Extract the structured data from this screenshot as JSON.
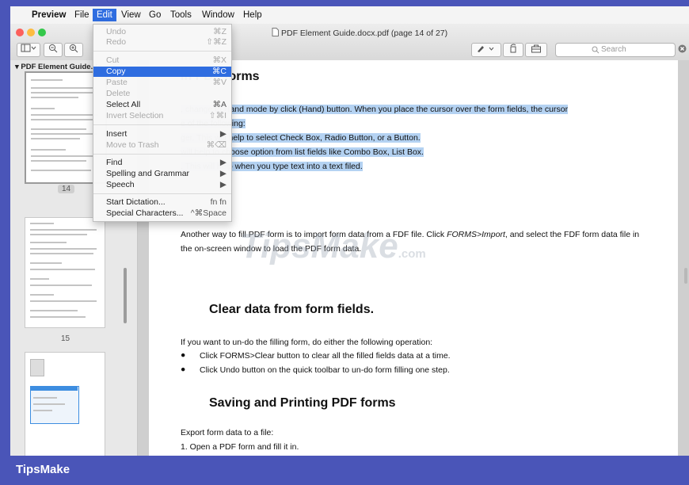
{
  "menubar": {
    "apple": "",
    "items": [
      "Preview",
      "File",
      "Edit",
      "View",
      "Go",
      "Tools",
      "Window",
      "Help"
    ]
  },
  "toolbar": {
    "doc_title": "PDF Element Guide.docx.pdf (page 14 of 27)",
    "search_placeholder": "Search",
    "zoom_out": "−",
    "zoom_in": "+"
  },
  "sidebar": {
    "title": "PDF Element Guide.do",
    "pages": [
      "14",
      "15"
    ]
  },
  "edit_menu": {
    "items": [
      {
        "label": "Undo",
        "shortcut": "⌘Z",
        "enabled": false
      },
      {
        "label": "Redo",
        "shortcut": "⇧⌘Z",
        "enabled": false
      },
      {
        "label": "Cut",
        "shortcut": "⌘X",
        "enabled": false
      },
      {
        "label": "Copy",
        "shortcut": "⌘C",
        "enabled": true,
        "selected": true
      },
      {
        "label": "Paste",
        "shortcut": "⌘V",
        "enabled": false
      },
      {
        "label": "Delete",
        "shortcut": "",
        "enabled": false
      },
      {
        "label": "Select All",
        "shortcut": "⌘A",
        "enabled": true
      },
      {
        "label": "Invert Selection",
        "shortcut": "⇧⌘I",
        "enabled": false
      },
      {
        "label": "Insert",
        "shortcut": "▶",
        "enabled": true
      },
      {
        "label": "Move to Trash",
        "shortcut": "⌘⌫",
        "enabled": false
      },
      {
        "label": "Find",
        "shortcut": "▶",
        "enabled": true
      },
      {
        "label": "Spelling and Grammar",
        "shortcut": "▶",
        "enabled": true
      },
      {
        "label": "Speech",
        "shortcut": "▶",
        "enabled": true
      },
      {
        "label": "Start Dictation...",
        "shortcut": "fn fn",
        "enabled": true
      },
      {
        "label": "Special Characters...",
        "shortcut": "^⌘Space",
        "enabled": true
      }
    ]
  },
  "document": {
    "heading1": "in PDF forms",
    "hl1": ", change to Hand mode by click (Hand) button. When you place the cursor over the form fields, the cursor",
    "hl2": "e of the following:",
    "hl3": "ger. This will help to select Check Box, Radio Button, or a Button.",
    "hl4": "will help to choose option from list fields like Combo Box, List Box.",
    "hl5": ". This will help when you type text into a text filed.",
    "para1_a": "Another way to fill PDF form is to import form data from a FDF file. Click ",
    "para1_b": "FORMS>Import",
    "para1_c": ", and select the FDF form data file in",
    "para1_d": "the on-screen window to load the PDF form data.",
    "heading2": "Clear data from form fields.",
    "para2": "If you want to un-do the filling form, do either the following operation:",
    "bullets": [
      "Click FORMS>Clear button to clear all the filled fields data at a time.",
      "Click Undo button on the quick toolbar to un-do form filling one step."
    ],
    "heading3": "Saving and Printing PDF forms",
    "para3": "Export form data to a file:",
    "step1": "1.   Open a PDF form and fill it in.",
    "watermark_main": "TipsMake",
    "watermark_suffix": ".com"
  },
  "footer": {
    "brand": "TipsMake"
  },
  "colors": {
    "accent": "#2f6de0",
    "highlight": "#b4d2f2",
    "banner": "#4a55b8"
  }
}
